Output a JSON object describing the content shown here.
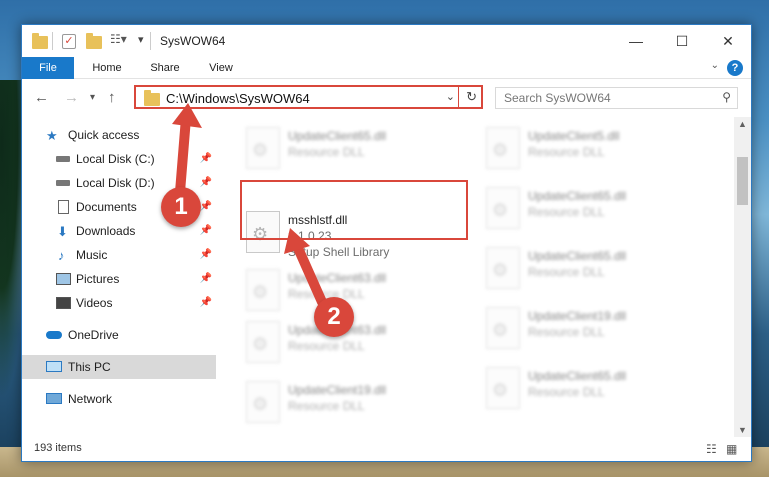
{
  "window": {
    "title": "SysWOW64",
    "controls": {
      "minimize": "—",
      "maximize": "☐",
      "close": "✕"
    }
  },
  "ribbon": {
    "tabs": [
      "File",
      "Home",
      "Share",
      "View"
    ],
    "help": "?"
  },
  "address": {
    "path": "C:\\Windows\\SysWOW64",
    "search_placeholder": "Search SysWOW64"
  },
  "nav": {
    "items": [
      {
        "label": "Quick access",
        "icon": "star-icon"
      },
      {
        "label": "Local Disk (C:)",
        "icon": "drive-icon",
        "pinned": true
      },
      {
        "label": "Local Disk (D:)",
        "icon": "drive-icon",
        "pinned": true
      },
      {
        "label": "Documents",
        "icon": "documents-icon",
        "pinned": true
      },
      {
        "label": "Downloads",
        "icon": "downloads-icon",
        "pinned": true
      },
      {
        "label": "Music",
        "icon": "music-icon",
        "pinned": true
      },
      {
        "label": "Pictures",
        "icon": "pictures-icon",
        "pinned": true
      },
      {
        "label": "Videos",
        "icon": "videos-icon",
        "pinned": true
      },
      {
        "label": "OneDrive",
        "icon": "cloud-icon"
      },
      {
        "label": "This PC",
        "icon": "computer-icon",
        "selected": true
      },
      {
        "label": "Network",
        "icon": "network-icon"
      }
    ]
  },
  "files": {
    "highlighted": {
      "name": "msshlstf.dll",
      "version": "2.1.0.23",
      "description": "Setup Shell Library"
    },
    "left": [
      {
        "name": "UpdateClient65.dll",
        "desc": "Resource DLL"
      },
      {
        "name": "UpdateClient63.dll",
        "desc": "Resource DLL"
      },
      {
        "name": "UpdateClient63.dll",
        "desc": "Resource DLL"
      },
      {
        "name": "UpdateClient19.dll",
        "desc": "Resource DLL"
      }
    ],
    "right": [
      {
        "name": "UpdateClient5.dll",
        "desc": "Resource DLL"
      },
      {
        "name": "UpdateClient65.dll",
        "desc": "Resource DLL"
      },
      {
        "name": "UpdateClient65.dll",
        "desc": "Resource DLL"
      },
      {
        "name": "UpdateClient19.dll",
        "desc": "Resource DLL"
      },
      {
        "name": "UpdateClient65.dll",
        "desc": "Resource DLL"
      }
    ]
  },
  "status": {
    "count": "193 items"
  },
  "annotations": {
    "marker1": "1",
    "marker2": "2",
    "color": "#d9473b"
  }
}
